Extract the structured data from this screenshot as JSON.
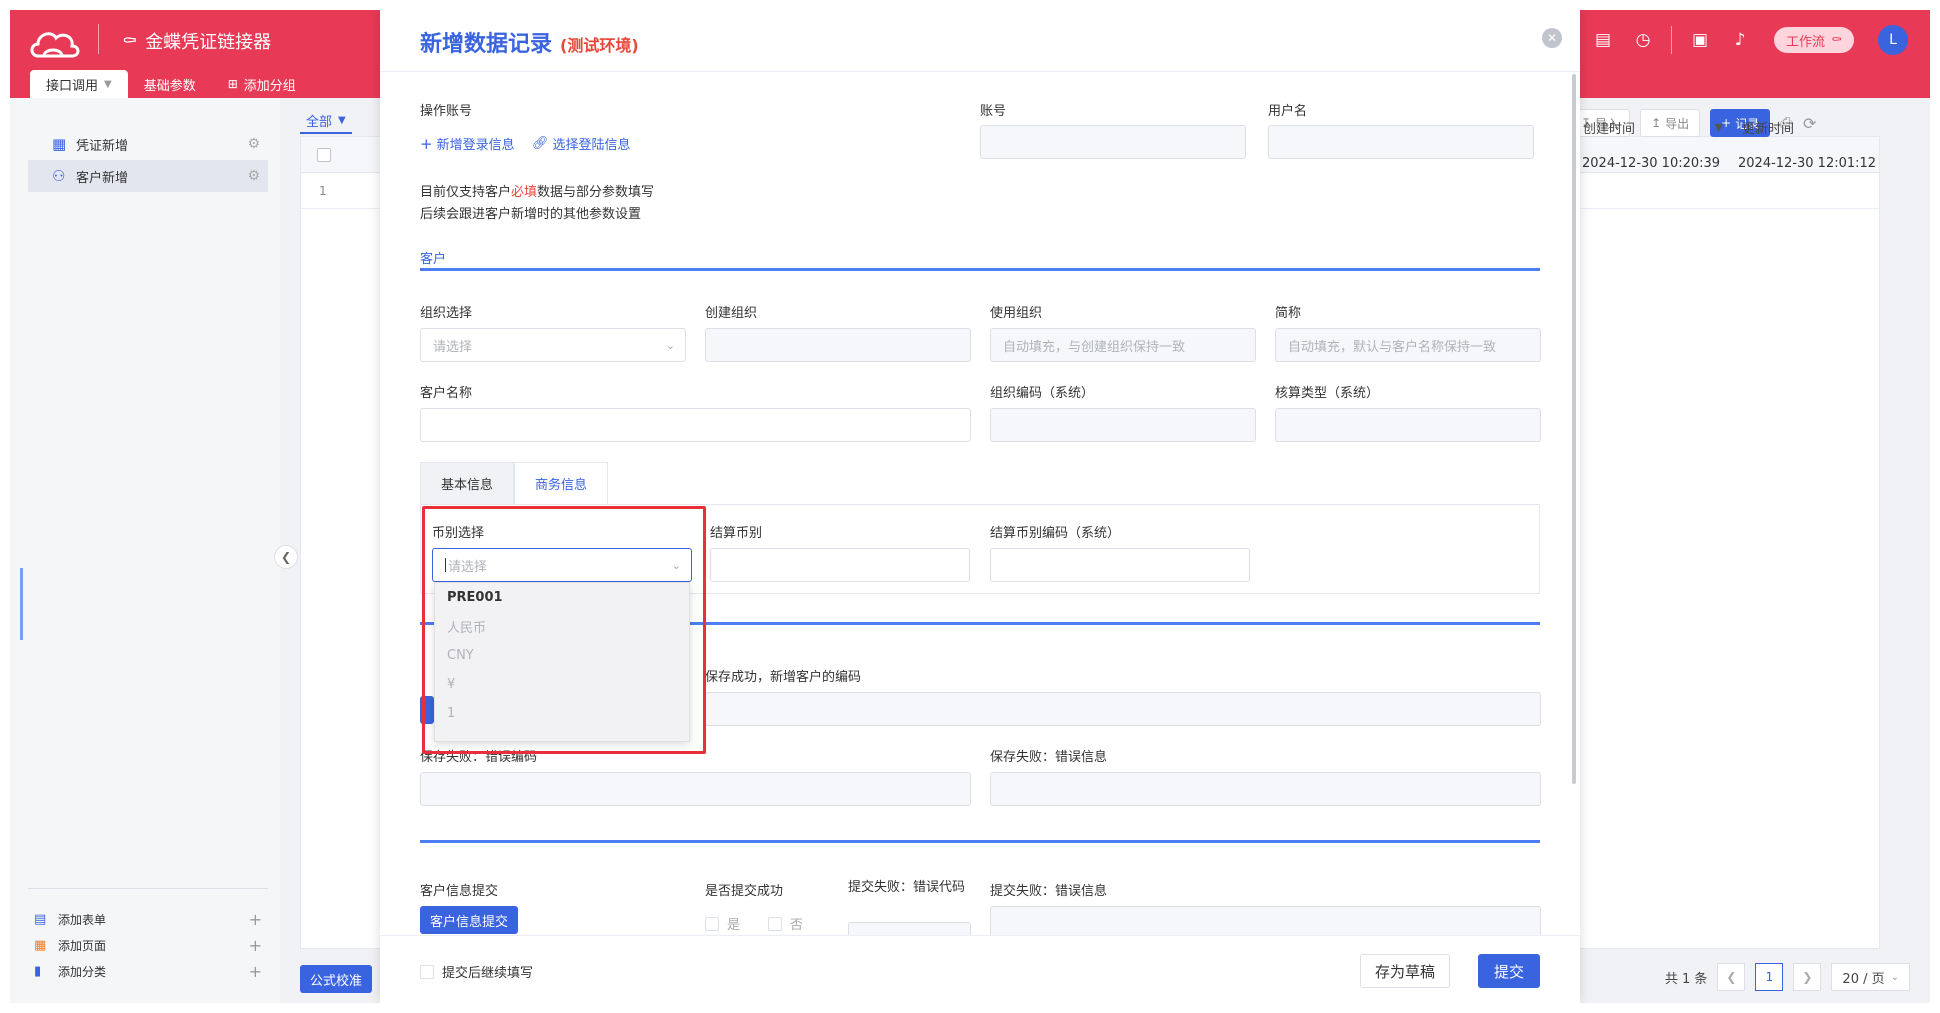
{
  "app": {
    "title": "金蝶凭证链接器",
    "tabs": [
      "接口调用",
      "基础参数",
      "添加分组"
    ],
    "workflow_label": "工作流",
    "avatar_letter": "L"
  },
  "sidebar": {
    "items": [
      {
        "label": "凭证新增"
      },
      {
        "label": "客户新增"
      }
    ],
    "footer": [
      {
        "label": "添加表单"
      },
      {
        "label": "添加页面"
      },
      {
        "label": "添加分类"
      }
    ]
  },
  "background": {
    "filter_label": "全部",
    "import_label": "导入",
    "export_label": "导出",
    "record_label": "记录",
    "columns": {
      "created": "创建时间",
      "updated": "更新时间"
    },
    "row": {
      "index": "1",
      "created": "2024-12-30 10:20:39",
      "updated": "2024-12-30 12:01:12"
    },
    "formula_label": "公式校准",
    "pager": {
      "total": "共 1 条",
      "current": "1",
      "size": "20 / 页"
    }
  },
  "modal": {
    "title": "新增数据记录",
    "env": "(测试环境)",
    "operator_label": "操作账号",
    "account_label": "账号",
    "username_label": "用户名",
    "add_login_link": "新增登录信息",
    "select_login_link": "选择登陆信息",
    "note": {
      "line1_a": "目前仅支持客户",
      "line1_red": "必填",
      "line1_b": "数据与部分参数填写",
      "line2": "后续会跟进客户新增时的其他参数设置"
    },
    "section_customer": "客户",
    "org_select_label": "组织选择",
    "org_select_placeholder": "请选择",
    "create_org_label": "创建组织",
    "use_org_label": "使用组织",
    "use_org_placeholder": "自动填充，与创建组织保持一致",
    "short_name_label": "简称",
    "short_name_placeholder": "自动填充，默认与客户名称保持一致",
    "customer_name_label": "客户名称",
    "org_code_label": "组织编码（系统）",
    "account_type_label": "核算类型（系统）",
    "subtabs": [
      "基本信息",
      "商务信息"
    ],
    "currency_select_label": "币别选择",
    "currency_placeholder": "请选择",
    "settle_currency_label": "结算币别",
    "settle_currency_code_label": "结算币别编码（系统）",
    "currency_options": [
      "PRE001",
      "人民币",
      "CNY",
      "¥",
      "1"
    ],
    "save_success_code_label": "保存成功，新增客户的编码",
    "save_fail_code_label": "保存失败：错误编码",
    "save_fail_msg_label": "保存失败：错误信息",
    "submit_section_label": "客户信息提交",
    "submit_info_button": "客户信息提交",
    "submit_success_label": "是否提交成功",
    "yes_label": "是",
    "no_label": "否",
    "submit_fail_code_label": "提交失败：错误代码",
    "submit_fail_msg_label": "提交失败：错误信息",
    "continue_label": "提交后继续填写",
    "draft_button": "存为草稿",
    "submit_button": "提交"
  },
  "colors": {
    "brand": "#e83a57",
    "accent": "#3a63e0",
    "highlight": "#e8303a"
  }
}
